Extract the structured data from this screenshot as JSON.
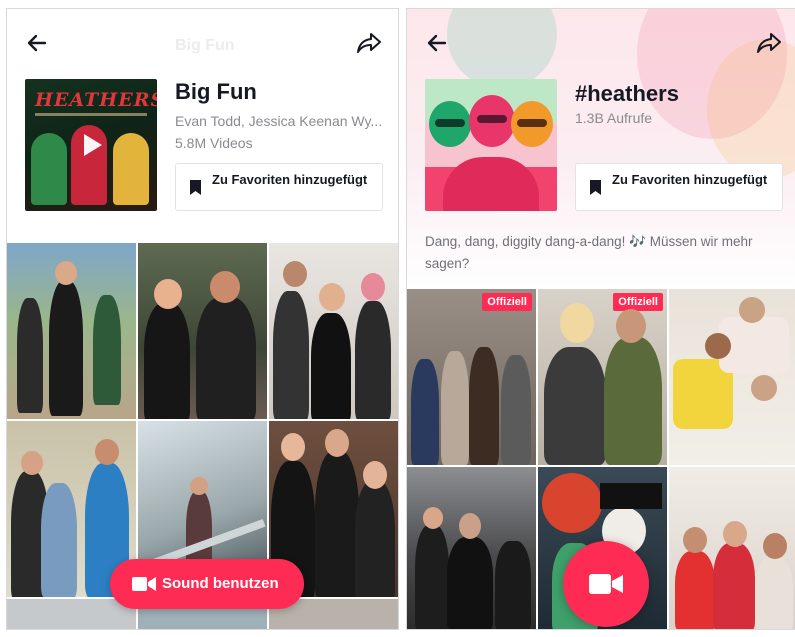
{
  "left": {
    "header_faint_title": "Big Fun",
    "cover_text": "HEATHERS",
    "title": "Big Fun",
    "artist": "Evan Todd, Jessica Keenan Wy...",
    "count": "5.8M Videos",
    "favorite_label": "Zu Favoriten hinzugefügt",
    "use_sound_label": "Sound benutzen"
  },
  "right": {
    "title": "#heathers",
    "views": "1.3B Aufrufe",
    "favorite_label": "Zu Favoriten hinzugefügt",
    "description": "Dang, dang, diggity dang-a-dang! 🎶 Müssen wir mehr sagen?",
    "badge_official": "Offiziell"
  },
  "colors": {
    "accent": "#fe2c55",
    "text": "#161823",
    "muted": "#8a8b91"
  },
  "icons": [
    "back-arrow-icon",
    "share-icon",
    "play-icon",
    "bookmark-icon",
    "video-camera-icon"
  ]
}
